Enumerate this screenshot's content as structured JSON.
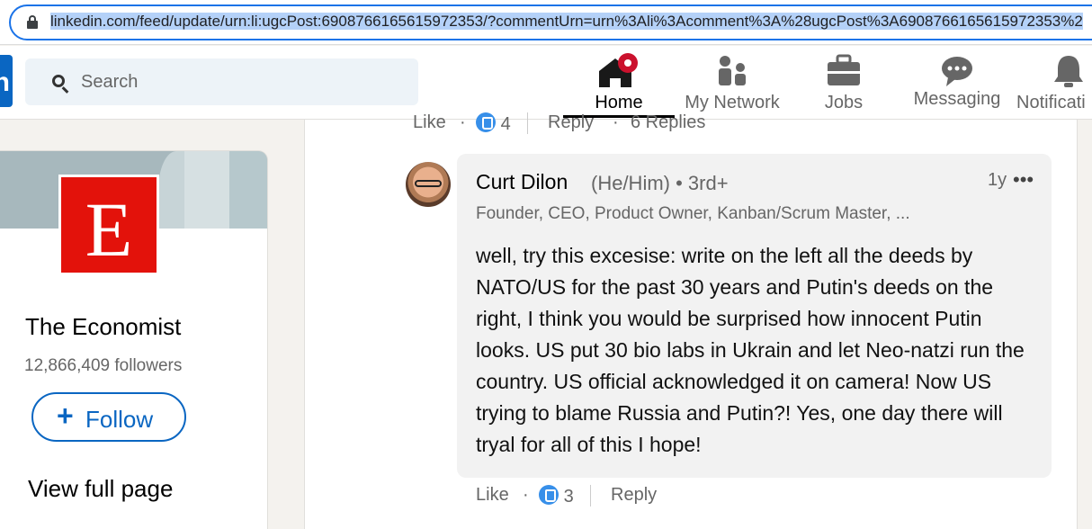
{
  "browser": {
    "url": "linkedin.com/feed/update/urn:li:ugcPost:6908766165615972353/?commentUrn=urn%3Ali%3Acomment%3A%28ugcPost%3A6908766165615972353%2"
  },
  "header": {
    "logo_text": "in",
    "search_placeholder": "Search",
    "nav": {
      "home": "Home",
      "network": "My Network",
      "jobs": "Jobs",
      "messaging": "Messaging",
      "notifications": "Notificati"
    }
  },
  "profile_card": {
    "logo_letter": "E",
    "name": "The Economist",
    "followers": "12,866,409 followers",
    "follow_plus": "+",
    "follow_label": "Follow",
    "view_full_page": "View full page",
    "brand_color": "#e3120b"
  },
  "previous_comment": {
    "like": "Like",
    "dot1": "·",
    "reaction_count": "4",
    "reply": "Reply",
    "dot2": "·",
    "replies": "6 Replies"
  },
  "comment": {
    "author": "Curt Dilon",
    "pronouns_degree": "(He/Him) • 3rd+",
    "headline": "Founder, CEO, Product Owner, Kanban/Scrum Master, ...",
    "time": "1y",
    "more": "•••",
    "text": "well, try this excesise: write on the left all the deeds by NATO/US for the past 30 years and Putin's deeds on the right, I think you would be surprised how innocent Putin looks. US put 30 bio labs in Ukrain and let Neo-natzi run the country. US official acknowledged it on camera! Now US trying to blame Russia and Putin?! Yes, one day there will tryal for all of this I hope!",
    "actions": {
      "like": "Like",
      "dot": "·",
      "reaction_count": "3",
      "reply": "Reply"
    }
  },
  "colors": {
    "accent": "#0a66c2",
    "notification_badge": "#cb112d",
    "page_bg": "#f4f2ee"
  }
}
